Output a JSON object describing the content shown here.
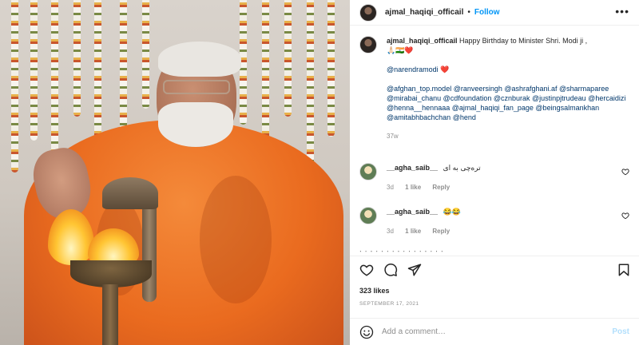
{
  "photo": {
    "alt": ""
  },
  "header": {
    "username": "ajmal_haqiqi_officail",
    "separator": "•",
    "follow_label": "Follow",
    "more_icon": "more-horizontal-icon"
  },
  "caption": {
    "username": "ajmal_haqiqi_officail",
    "text": "Happy Birthday to Minister Shri. Modi ji ,",
    "line2": "🙏🏻🇮🇳❤️",
    "mention_line": "@narendramodi ❤️",
    "tags": "@afghan_top.model @ranveersingh @ashrafghani.af @sharmaparee @mirabai_chanu @cdfoundation @cznburak @justinpjtrudeau @hercaidizi @henna__hennaaa @ajmal_haqiqi_fan_page @beingsalmankhan @amitabhbachchan @hend",
    "time": "37w"
  },
  "comments": [
    {
      "username": "__agha_saib__",
      "text": "ترەچی بە ای",
      "time": "3d",
      "likes": "1 like",
      "reply": "Reply"
    },
    {
      "username": "__agha_saib__",
      "text": "😂😂",
      "time": "3d",
      "likes": "1 like",
      "reply": "Reply"
    }
  ],
  "partial_comment": "ᐧ ᐧ ᐧ ᐧ ᐧ ᐧ ᐧ ᐧ ᐧ ᐧ ᐧ ᐧ ᐧ ᐧ ᐧ ᐧ",
  "actions": {
    "like_icon": "heart-icon",
    "comment_icon": "comment-icon",
    "share_icon": "share-icon",
    "save_icon": "bookmark-icon"
  },
  "likes_count": "323 likes",
  "post_date": "SEPTEMBER 17, 2021",
  "add_comment": {
    "placeholder": "Add a comment…",
    "post_label": "Post",
    "emoji_icon": "smiley-icon"
  },
  "colors": {
    "link": "#0095f6",
    "mention": "#00376b",
    "muted": "#8e8e8e",
    "post_disabled": "#b2dffc",
    "robe": "#ea6b1f"
  }
}
